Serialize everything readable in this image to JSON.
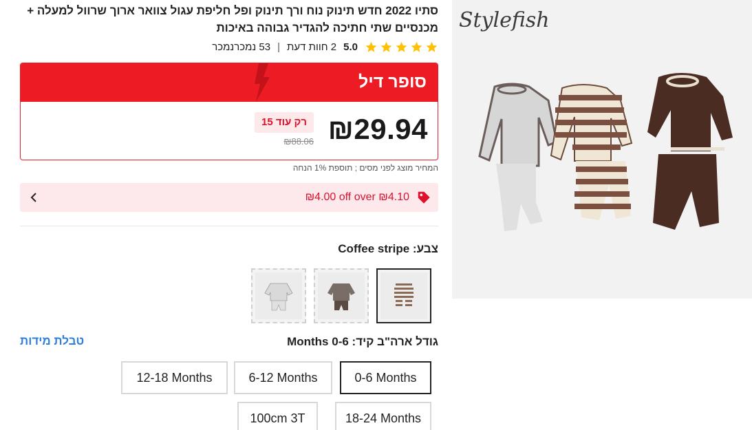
{
  "product": {
    "title": "סתיו 2022 חדש תינוק נוח ורך תינוק ופל חליפת עגול צוואר ארוך שרוול למעלה + מכנסיים שתי חתיכה להגדיר גבוהה באיכות",
    "brand_logo": "Stylefish"
  },
  "rating": {
    "value": "5.0",
    "stars": 5,
    "reviews": "2 חוות דעת",
    "sold": "53 נמכרנמכר"
  },
  "deal": {
    "title": "סופר דיל",
    "price": "₪29.94",
    "old_price": "₪88.06",
    "stock": "רק עוד 15",
    "tax_note": "המחיר מוצג לפני מסים ; תוספת 1% הנחה"
  },
  "coupon": {
    "text": "₪4.00 off over ₪4.10",
    "icon": "tag-icon"
  },
  "color": {
    "label": "צבע: Coffee stripe",
    "options": [
      "Coffee stripe",
      "Coffee",
      "Light gray"
    ]
  },
  "size": {
    "label": "גודל ארה\"ב קיד: 0-6 Months",
    "chart_link": "טבלת מידות",
    "options": [
      "0-6 Months",
      "6-12 Months",
      "12-18 Months",
      "18-24 Months",
      "100cm 3T"
    ],
    "selected": "0-6 Months"
  },
  "colors": {
    "accent": "#ed1c24",
    "star": "#ffc107",
    "link": "#2f7fdc"
  }
}
